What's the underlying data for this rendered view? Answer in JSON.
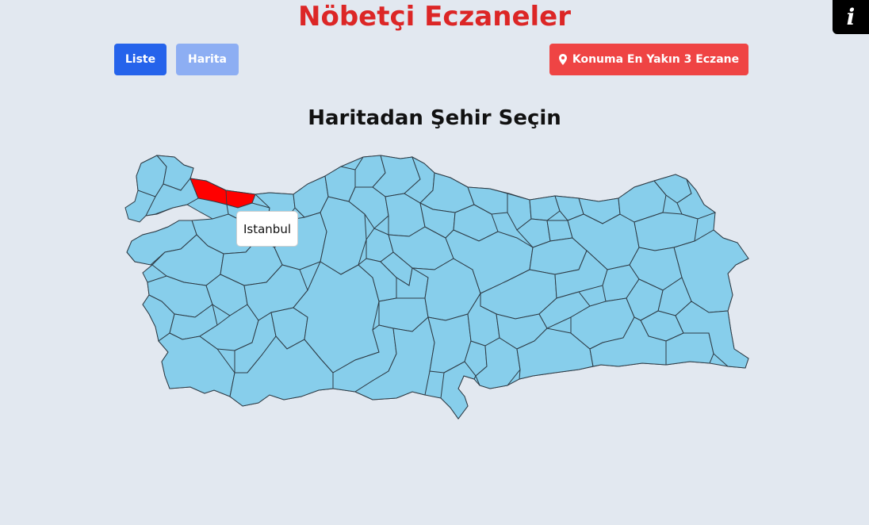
{
  "header": {
    "title": "Nöbetçi Eczaneler",
    "info_icon": "i"
  },
  "toolbar": {
    "liste_label": "Liste",
    "harita_label": "Harita",
    "nearest_label": "Konuma En Yakın 3 Eczane",
    "nearest_icon": "map-pin-icon"
  },
  "map": {
    "heading": "Haritadan Şehir Seçin",
    "hovered_city": "Istanbul",
    "fill_color": "#87ceeb",
    "selected_color": "#ff0000"
  },
  "colors": {
    "title": "#dc2626",
    "liste_button": "#2563eb",
    "harita_button": "#8daef3",
    "nearest_button": "#ef4444",
    "background": "#e2e8f0"
  }
}
